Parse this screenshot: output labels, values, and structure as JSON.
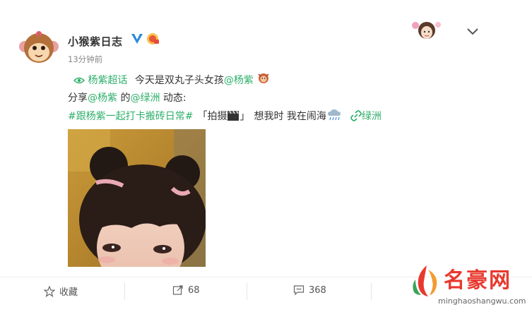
{
  "post": {
    "username": "小猴紫日志",
    "time": "13分钟前",
    "supertopic_link": "杨紫超话",
    "line1_text": "今天是双丸子头女孩",
    "mention_yangzi": "@杨紫",
    "share_prefix": "分享",
    "share_mid": " 的",
    "mention_oasis": "@绿洲",
    "share_suffix": " 动态:",
    "hashtag": "#跟杨紫一起打卡搬砖日常#",
    "bracket_open": "「拍摄",
    "bracket_close": "」",
    "line3_text": "想我时 我在闹海",
    "oasis_link": "绿洲"
  },
  "footer": {
    "favorite_label": "收藏",
    "forward_count": "68",
    "comment_count": "368"
  },
  "watermark": {
    "title": "名豪网",
    "url": "minghaoshangwu.com"
  },
  "colors": {
    "link": "#2eaf6a",
    "verified": "#2b8ad9",
    "watermark": "#e8392e"
  },
  "icons": [
    "monkey-avatar-icon",
    "verified-v-icon",
    "vip-badge-icon",
    "chevron-down-icon",
    "eye-icon",
    "mascot-icon",
    "clapperboard-icon",
    "cloud-rain-icon",
    "link-icon",
    "star-icon",
    "forward-icon",
    "comment-icon"
  ]
}
